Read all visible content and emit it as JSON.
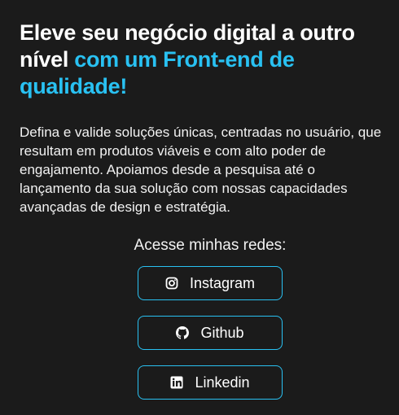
{
  "hero": {
    "headline_plain": "Eleve seu negócio digital a outro nível ",
    "headline_accent": "com um Front-end de qualidade!",
    "description": "Defina e valide soluções únicas, centradas no usuário, que resultam em produtos viáveis e com alto poder de engajamento. Apoiamos desde a pesquisa até o lançamento da sua solução com nossas capacidades avançadas de design e estratégia."
  },
  "social": {
    "title": "Acesse minhas redes:",
    "links": [
      {
        "label": "Instagram",
        "icon": "instagram-icon"
      },
      {
        "label": "Github",
        "icon": "github-icon"
      },
      {
        "label": "Linkedin",
        "icon": "linkedin-icon"
      }
    ]
  },
  "colors": {
    "background": "#1b1b1b",
    "accent": "#29c1f2",
    "text": "#ffffff"
  }
}
